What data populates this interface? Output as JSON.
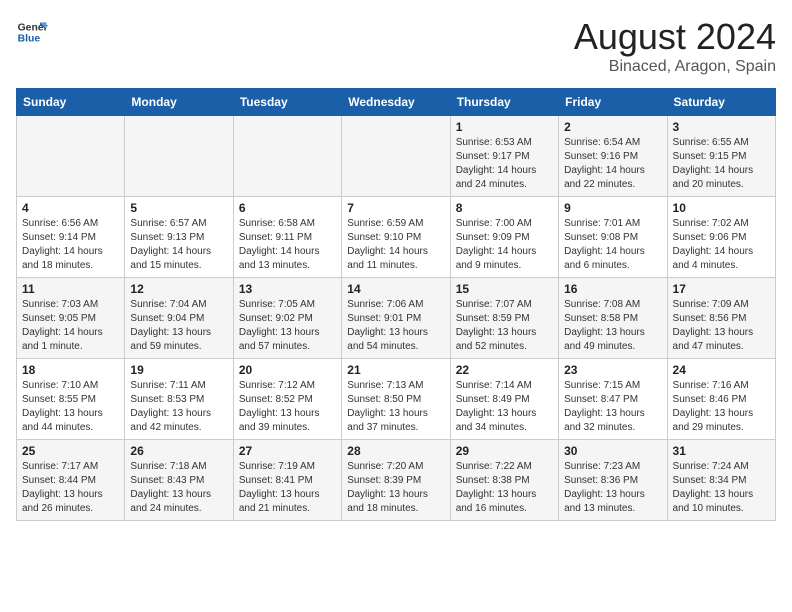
{
  "header": {
    "logo_line1": "General",
    "logo_line2": "Blue",
    "title": "August 2024",
    "subtitle": "Binaced, Aragon, Spain"
  },
  "days_of_week": [
    "Sunday",
    "Monday",
    "Tuesday",
    "Wednesday",
    "Thursday",
    "Friday",
    "Saturday"
  ],
  "weeks": [
    [
      {
        "day": "",
        "info": ""
      },
      {
        "day": "",
        "info": ""
      },
      {
        "day": "",
        "info": ""
      },
      {
        "day": "",
        "info": ""
      },
      {
        "day": "1",
        "info": "Sunrise: 6:53 AM\nSunset: 9:17 PM\nDaylight: 14 hours\nand 24 minutes."
      },
      {
        "day": "2",
        "info": "Sunrise: 6:54 AM\nSunset: 9:16 PM\nDaylight: 14 hours\nand 22 minutes."
      },
      {
        "day": "3",
        "info": "Sunrise: 6:55 AM\nSunset: 9:15 PM\nDaylight: 14 hours\nand 20 minutes."
      }
    ],
    [
      {
        "day": "4",
        "info": "Sunrise: 6:56 AM\nSunset: 9:14 PM\nDaylight: 14 hours\nand 18 minutes."
      },
      {
        "day": "5",
        "info": "Sunrise: 6:57 AM\nSunset: 9:13 PM\nDaylight: 14 hours\nand 15 minutes."
      },
      {
        "day": "6",
        "info": "Sunrise: 6:58 AM\nSunset: 9:11 PM\nDaylight: 14 hours\nand 13 minutes."
      },
      {
        "day": "7",
        "info": "Sunrise: 6:59 AM\nSunset: 9:10 PM\nDaylight: 14 hours\nand 11 minutes."
      },
      {
        "day": "8",
        "info": "Sunrise: 7:00 AM\nSunset: 9:09 PM\nDaylight: 14 hours\nand 9 minutes."
      },
      {
        "day": "9",
        "info": "Sunrise: 7:01 AM\nSunset: 9:08 PM\nDaylight: 14 hours\nand 6 minutes."
      },
      {
        "day": "10",
        "info": "Sunrise: 7:02 AM\nSunset: 9:06 PM\nDaylight: 14 hours\nand 4 minutes."
      }
    ],
    [
      {
        "day": "11",
        "info": "Sunrise: 7:03 AM\nSunset: 9:05 PM\nDaylight: 14 hours\nand 1 minute."
      },
      {
        "day": "12",
        "info": "Sunrise: 7:04 AM\nSunset: 9:04 PM\nDaylight: 13 hours\nand 59 minutes."
      },
      {
        "day": "13",
        "info": "Sunrise: 7:05 AM\nSunset: 9:02 PM\nDaylight: 13 hours\nand 57 minutes."
      },
      {
        "day": "14",
        "info": "Sunrise: 7:06 AM\nSunset: 9:01 PM\nDaylight: 13 hours\nand 54 minutes."
      },
      {
        "day": "15",
        "info": "Sunrise: 7:07 AM\nSunset: 8:59 PM\nDaylight: 13 hours\nand 52 minutes."
      },
      {
        "day": "16",
        "info": "Sunrise: 7:08 AM\nSunset: 8:58 PM\nDaylight: 13 hours\nand 49 minutes."
      },
      {
        "day": "17",
        "info": "Sunrise: 7:09 AM\nSunset: 8:56 PM\nDaylight: 13 hours\nand 47 minutes."
      }
    ],
    [
      {
        "day": "18",
        "info": "Sunrise: 7:10 AM\nSunset: 8:55 PM\nDaylight: 13 hours\nand 44 minutes."
      },
      {
        "day": "19",
        "info": "Sunrise: 7:11 AM\nSunset: 8:53 PM\nDaylight: 13 hours\nand 42 minutes."
      },
      {
        "day": "20",
        "info": "Sunrise: 7:12 AM\nSunset: 8:52 PM\nDaylight: 13 hours\nand 39 minutes."
      },
      {
        "day": "21",
        "info": "Sunrise: 7:13 AM\nSunset: 8:50 PM\nDaylight: 13 hours\nand 37 minutes."
      },
      {
        "day": "22",
        "info": "Sunrise: 7:14 AM\nSunset: 8:49 PM\nDaylight: 13 hours\nand 34 minutes."
      },
      {
        "day": "23",
        "info": "Sunrise: 7:15 AM\nSunset: 8:47 PM\nDaylight: 13 hours\nand 32 minutes."
      },
      {
        "day": "24",
        "info": "Sunrise: 7:16 AM\nSunset: 8:46 PM\nDaylight: 13 hours\nand 29 minutes."
      }
    ],
    [
      {
        "day": "25",
        "info": "Sunrise: 7:17 AM\nSunset: 8:44 PM\nDaylight: 13 hours\nand 26 minutes."
      },
      {
        "day": "26",
        "info": "Sunrise: 7:18 AM\nSunset: 8:43 PM\nDaylight: 13 hours\nand 24 minutes."
      },
      {
        "day": "27",
        "info": "Sunrise: 7:19 AM\nSunset: 8:41 PM\nDaylight: 13 hours\nand 21 minutes."
      },
      {
        "day": "28",
        "info": "Sunrise: 7:20 AM\nSunset: 8:39 PM\nDaylight: 13 hours\nand 18 minutes."
      },
      {
        "day": "29",
        "info": "Sunrise: 7:22 AM\nSunset: 8:38 PM\nDaylight: 13 hours\nand 16 minutes."
      },
      {
        "day": "30",
        "info": "Sunrise: 7:23 AM\nSunset: 8:36 PM\nDaylight: 13 hours\nand 13 minutes."
      },
      {
        "day": "31",
        "info": "Sunrise: 7:24 AM\nSunset: 8:34 PM\nDaylight: 13 hours\nand 10 minutes."
      }
    ]
  ]
}
